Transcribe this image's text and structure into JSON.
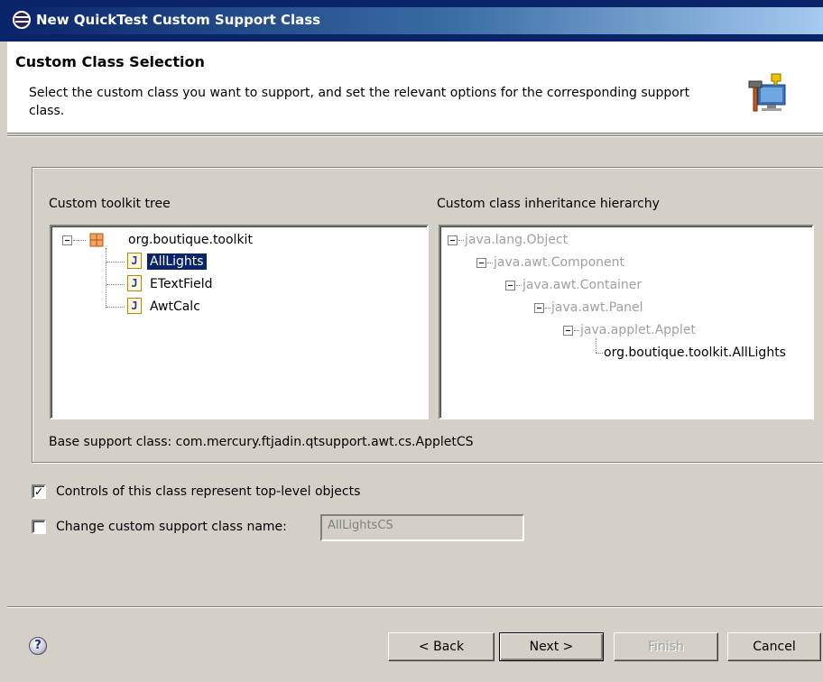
{
  "window": {
    "title": "New QuickTest Custom Support Class"
  },
  "header": {
    "title": "Custom Class Selection",
    "description": "Select the custom class you want to support, and set the relevant options for the corresponding support class.",
    "icon": "wizard-hammer-icon"
  },
  "toolkit_tree": {
    "label": "Custom toolkit tree",
    "root": "org.boutique.toolkit",
    "items": [
      "AllLights",
      "ETextField",
      "AwtCalc"
    ],
    "selected": "AllLights"
  },
  "hierarchy": {
    "label": "Custom class inheritance hierarchy",
    "items": [
      "java.lang.Object",
      "java.awt.Component",
      "java.awt.Container",
      "java.awt.Panel",
      "java.applet.Applet",
      "org.boutique.toolkit.AllLights"
    ]
  },
  "base_support": {
    "text": "Base support class: com.mercury.ftjadin.qtsupport.awt.cs.AppletCS"
  },
  "options": {
    "top_level_label": "Controls of this class represent top-level objects",
    "top_level_checked": true,
    "change_name_label": "Change custom support class name:",
    "change_name_checked": false,
    "class_name_value": "AllLightsCS"
  },
  "buttons": {
    "back": "< Back",
    "next": "Next >",
    "finish": "Finish",
    "cancel": "Cancel",
    "help": "?"
  },
  "colors": {
    "selection": "#0a246a",
    "dialog_bg": "#d4d0c8"
  }
}
